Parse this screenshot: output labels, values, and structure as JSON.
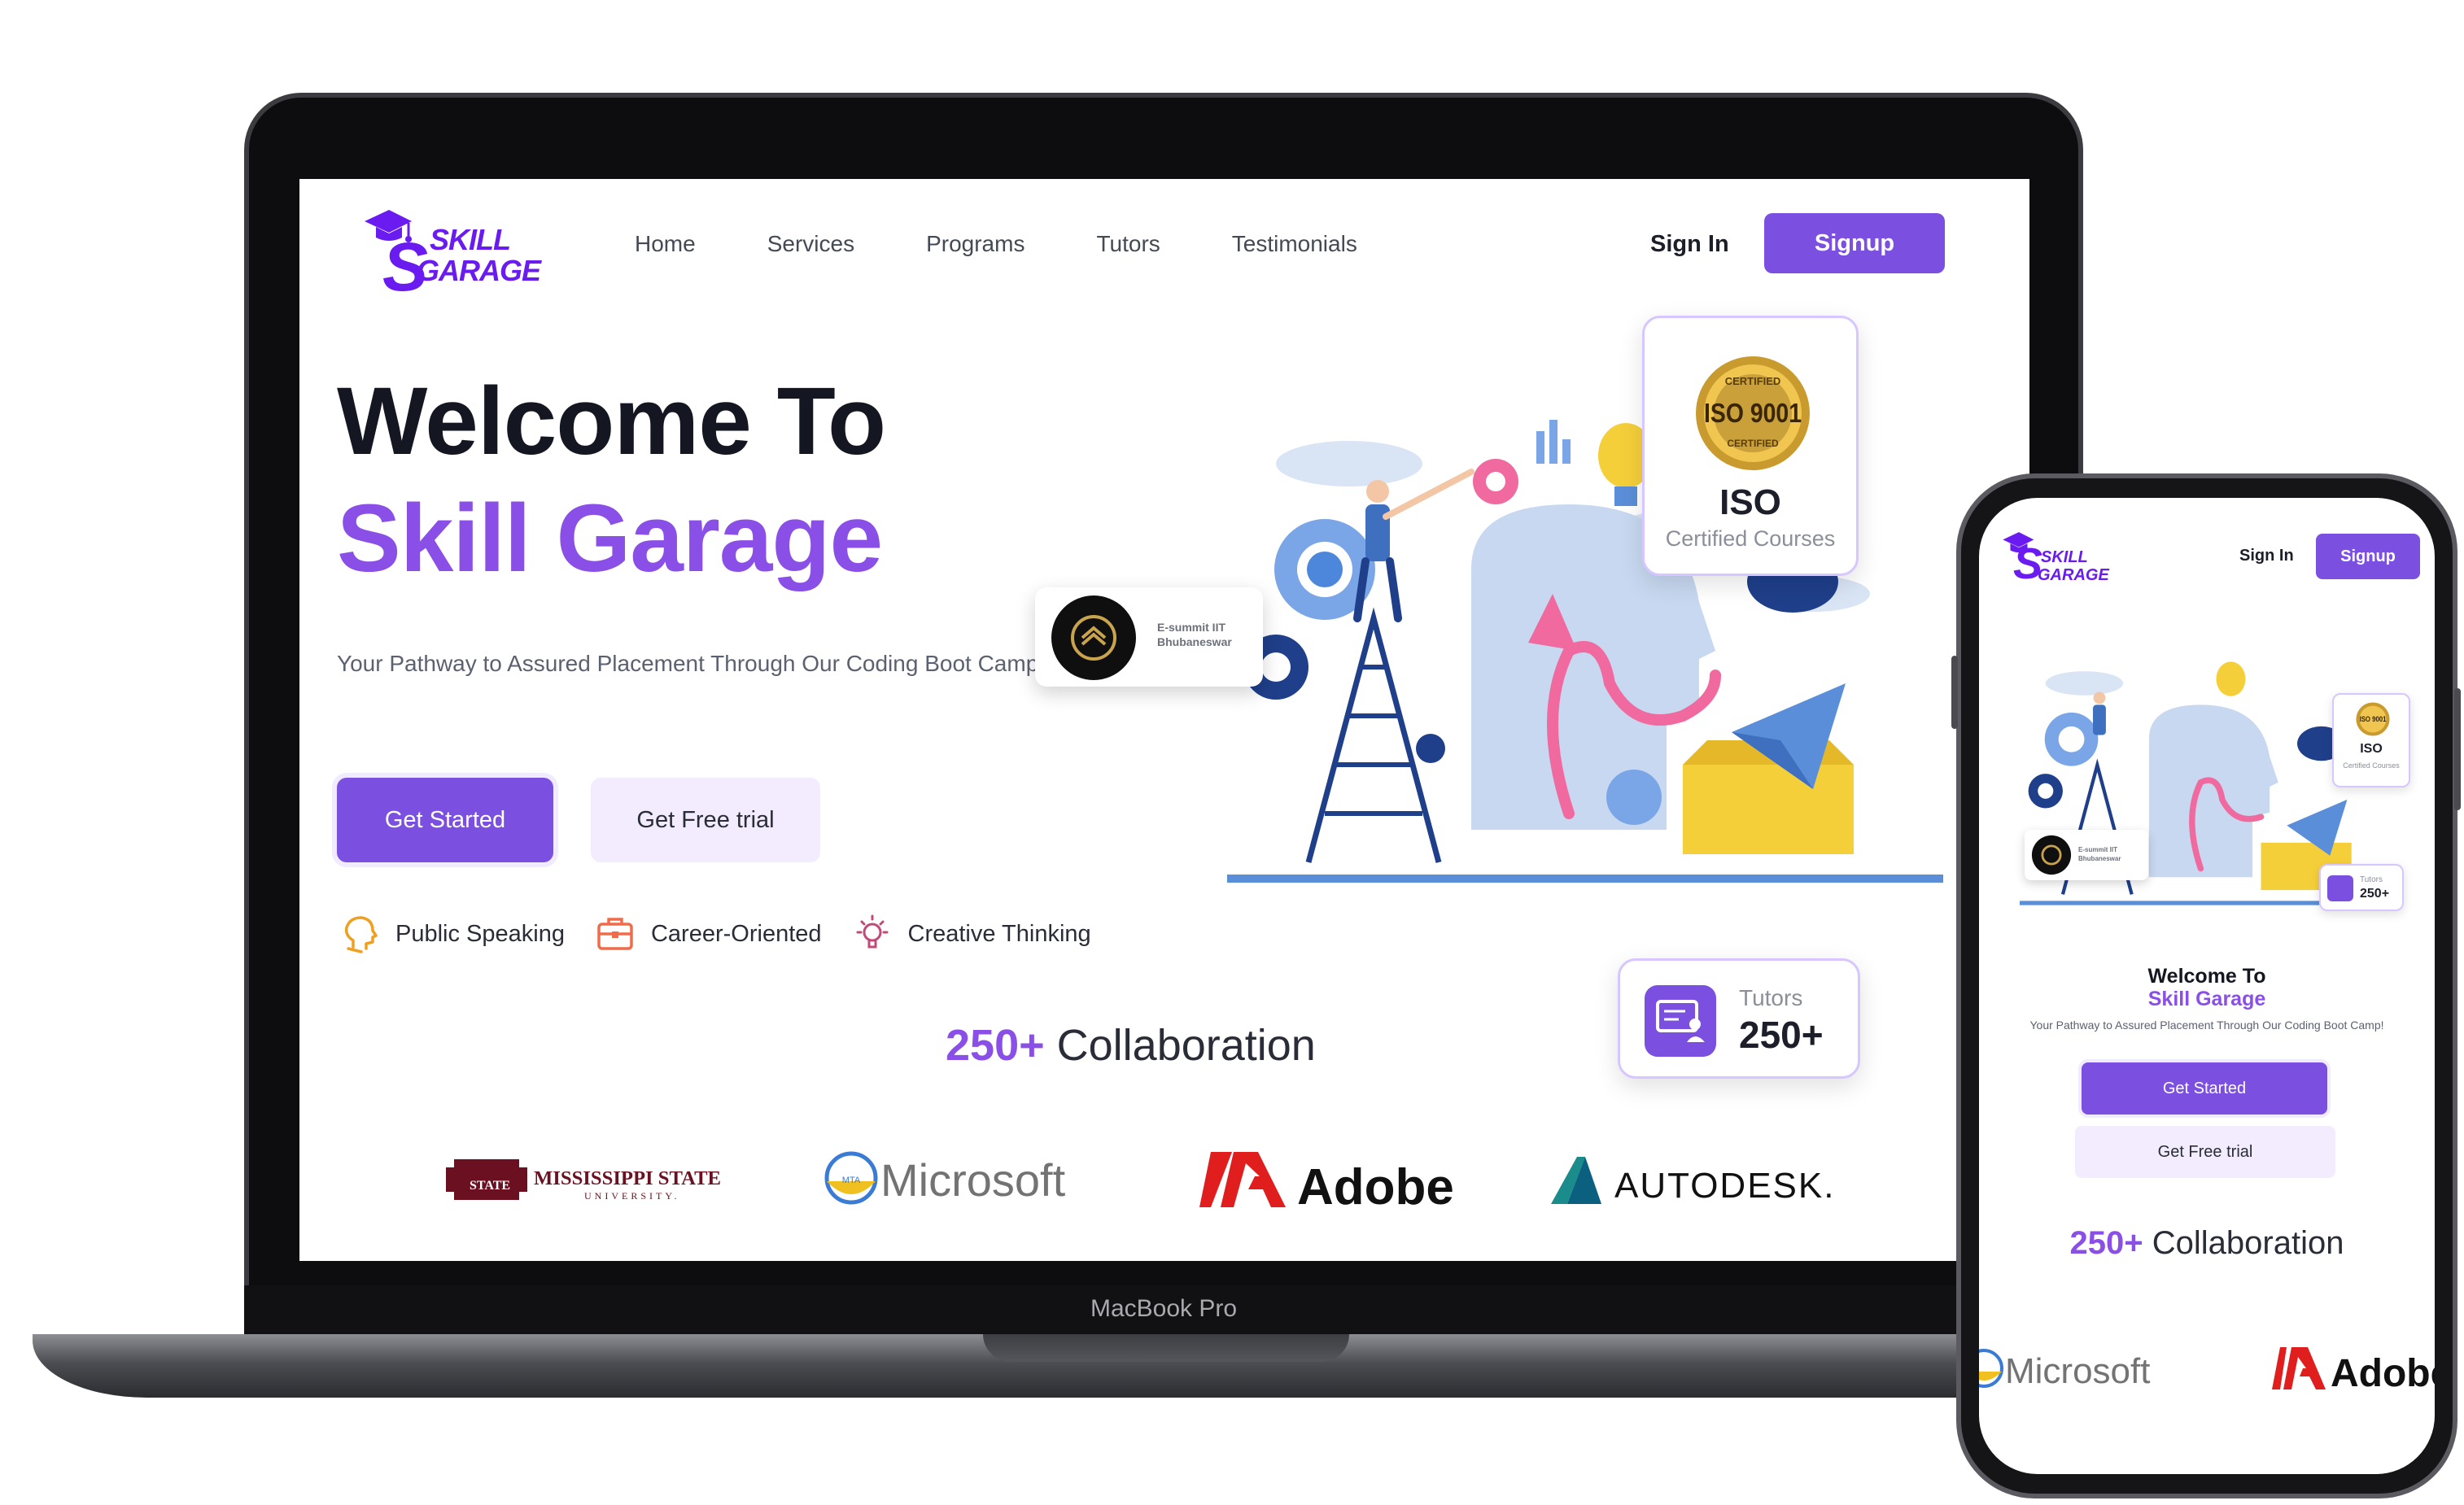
{
  "device": {
    "laptop_model": "MacBook Pro"
  },
  "brand": {
    "logo_line1": "SKILL",
    "logo_line2": "GARAGE",
    "logo_s": "S",
    "primary_color": "#7b4fe0",
    "accent_text_color": "#8a4fe6"
  },
  "nav": {
    "items": [
      "Home",
      "Services",
      "Programs",
      "Tutors",
      "Testimonials"
    ],
    "sign_in": "Sign In",
    "signup": "Signup"
  },
  "hero": {
    "title_line1": "Welcome To",
    "title_line2": "Skill Garage",
    "subtitle": "Your Pathway to Assured Placement Through Our Coding Boot Camp!",
    "get_started": "Get Started",
    "free_trial": "Get Free trial"
  },
  "features": [
    {
      "icon": "head-speaking-icon",
      "label": "Public Speaking"
    },
    {
      "icon": "briefcase-icon",
      "label": "Career-Oriented"
    },
    {
      "icon": "lightbulb-icon",
      "label": "Creative Thinking"
    }
  ],
  "badges": {
    "iso_seal_top": "CERTIFIED",
    "iso_seal_main": "ISO 9001",
    "iso_seal_bottom": "CERTIFIED",
    "iso_title": "ISO",
    "iso_subtitle": "Certified Courses",
    "esummit_line1": "E-summit IIT",
    "esummit_line2": "Bhubaneswar",
    "tutors_label": "Tutors",
    "tutors_value": "250+"
  },
  "collaboration": {
    "count": "250+",
    "label": " Collaboration"
  },
  "partners": {
    "mississippi": "MISSISSIPPI STATE",
    "mississippi_sub": "UNIVERSITY.",
    "mississippi_badge": "STATE",
    "microsoft": "Microsoft",
    "microsoft_badge": "MTA",
    "adobe": "Adobe",
    "autodesk": "AUTODESK."
  }
}
